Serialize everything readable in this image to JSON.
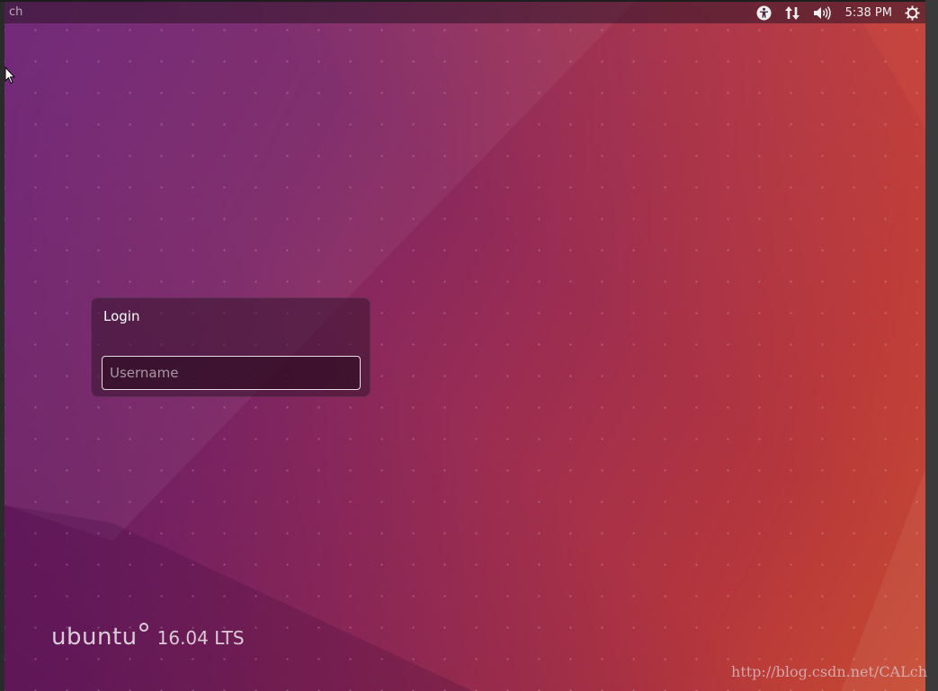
{
  "topbar": {
    "left_label": "ch",
    "time": "5:38 PM",
    "indicators": [
      {
        "icon": "accessibility-icon"
      },
      {
        "icon": "network-arrows-icon"
      },
      {
        "icon": "volume-icon"
      },
      {
        "icon": "power-gear-icon"
      }
    ]
  },
  "login": {
    "title": "Login",
    "username_placeholder": "Username",
    "username_value": ""
  },
  "branding": {
    "name": "ubuntu",
    "version": "16.04 LTS"
  },
  "watermark": "http://blog.csdn.net/CALch",
  "colors": {
    "bg_purple": "#6a1f73",
    "bg_orange": "#c84a30",
    "panel": "#37142d"
  }
}
